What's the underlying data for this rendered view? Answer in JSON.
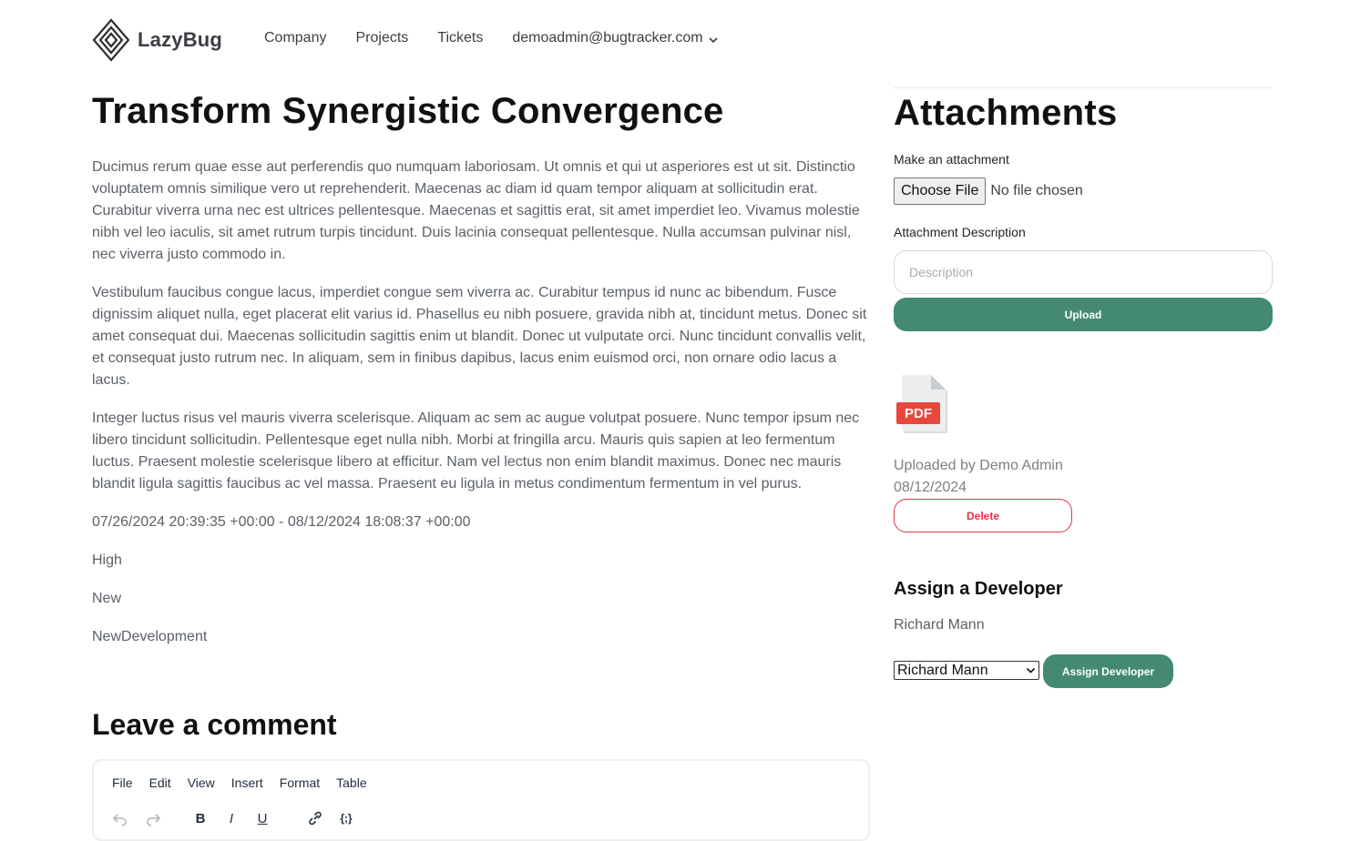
{
  "brand": {
    "name": "LazyBug"
  },
  "nav": {
    "items": [
      {
        "label": "Company"
      },
      {
        "label": "Projects"
      },
      {
        "label": "Tickets"
      }
    ],
    "user_email": "demoadmin@bugtracker.com"
  },
  "ticket": {
    "title": "Transform Synergistic Convergence",
    "paragraphs": [
      "Ducimus rerum quae esse aut perferendis quo numquam laboriosam. Ut omnis et qui ut asperiores est ut sit. Distinctio voluptatem omnis similique vero ut reprehenderit. Maecenas ac diam id quam tempor aliquam at sollicitudin erat. Curabitur viverra urna nec est ultrices pellentesque. Maecenas et sagittis erat, sit amet imperdiet leo. Vivamus molestie nibh vel leo iaculis, sit amet rutrum turpis tincidunt. Duis lacinia consequat pellentesque. Nulla accumsan pulvinar nisl, nec viverra justo commodo in.",
      "Vestibulum faucibus congue lacus, imperdiet congue sem viverra ac. Curabitur tempus id nunc ac bibendum. Fusce dignissim aliquet nulla, eget placerat elit varius id. Phasellus eu nibh posuere, gravida nibh at, tincidunt metus. Donec sit amet consequat dui. Maecenas sollicitudin sagittis enim ut blandit. Donec ut vulputate orci. Nunc tincidunt convallis velit, et consequat justo rutrum nec. In aliquam, sem in finibus dapibus, lacus enim euismod orci, non ornare odio lacus a lacus.",
      "Integer luctus risus vel mauris viverra scelerisque. Aliquam ac sem ac augue volutpat posuere. Nunc tempor ipsum nec libero tincidunt sollicitudin. Pellentesque eget nulla nibh. Morbi at fringilla arcu. Mauris quis sapien at leo fermentum luctus. Praesent molestie scelerisque libero at efficitur. Nam vel lectus non enim blandit maximus. Donec nec mauris blandit ligula sagittis faucibus ac vel massa. Praesent eu ligula in metus condimentum fermentum in vel purus."
    ],
    "dates": "07/26/2024 20:39:35 +00:00 - 08/12/2024 18:08:37 +00:00",
    "priority": "High",
    "status": "New",
    "type": "NewDevelopment"
  },
  "comment": {
    "title": "Leave a comment",
    "menu": [
      "File",
      "Edit",
      "View",
      "Insert",
      "Format",
      "Table"
    ],
    "toolbar": {
      "bold": "B",
      "italic": "I",
      "underline": "U",
      "code": "{;}"
    }
  },
  "attachments": {
    "title": "Attachments",
    "make_label": "Make an attachment",
    "choose_file": "Choose File",
    "no_file": "No file chosen",
    "description_label": "Attachment Description",
    "description_placeholder": "Description",
    "upload_label": "Upload",
    "file_icon_text": "PDF",
    "uploaded_by": "Uploaded by Demo Admin",
    "uploaded_date": "08/12/2024",
    "delete_label": "Delete"
  },
  "assign": {
    "title": "Assign a Developer",
    "current_developer": "Richard Mann",
    "selected_option": "Richard Mann",
    "button_label": "Assign Developer"
  },
  "colors": {
    "primary": "#438a70",
    "danger": "#dc3545",
    "pdf_red": "#e8473c"
  }
}
